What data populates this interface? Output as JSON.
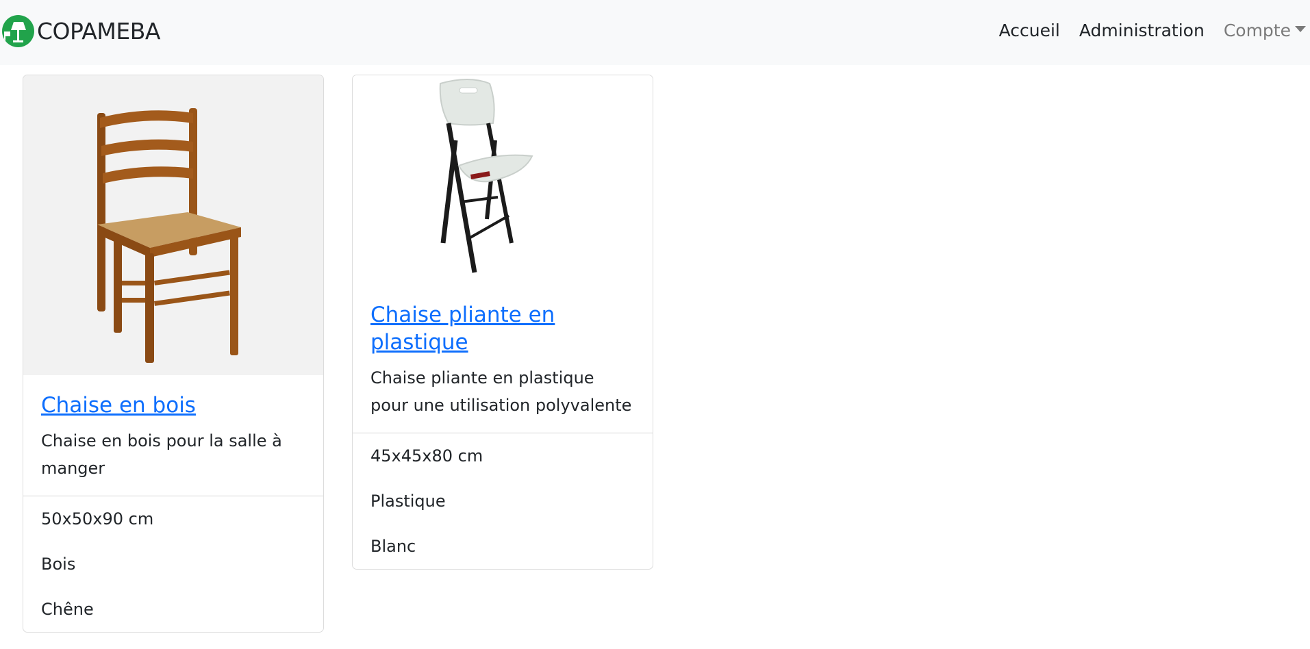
{
  "brand": {
    "name": "COPAMEBA",
    "logo_icon": "lamp-logo-icon",
    "logo_color": "#21a34b"
  },
  "nav": {
    "items": [
      {
        "label": "Accueil"
      },
      {
        "label": "Administration"
      },
      {
        "label": "Compte"
      }
    ]
  },
  "products": [
    {
      "title": "Chaise en bois",
      "description": "Chaise en bois pour la salle à manger",
      "specs": [
        "50x50x90 cm",
        "Bois",
        "Chêne"
      ],
      "image_icon": "wooden-chair-image"
    },
    {
      "title": "Chaise pliante en plastique",
      "description": "Chaise pliante en plastique pour une utilisation polyvalente",
      "specs": [
        "45x45x80 cm",
        "Plastique",
        "Blanc"
      ],
      "image_icon": "folding-chair-image"
    }
  ],
  "colors": {
    "link": "#0d6efd",
    "navbar_bg": "#f8f9fa"
  }
}
